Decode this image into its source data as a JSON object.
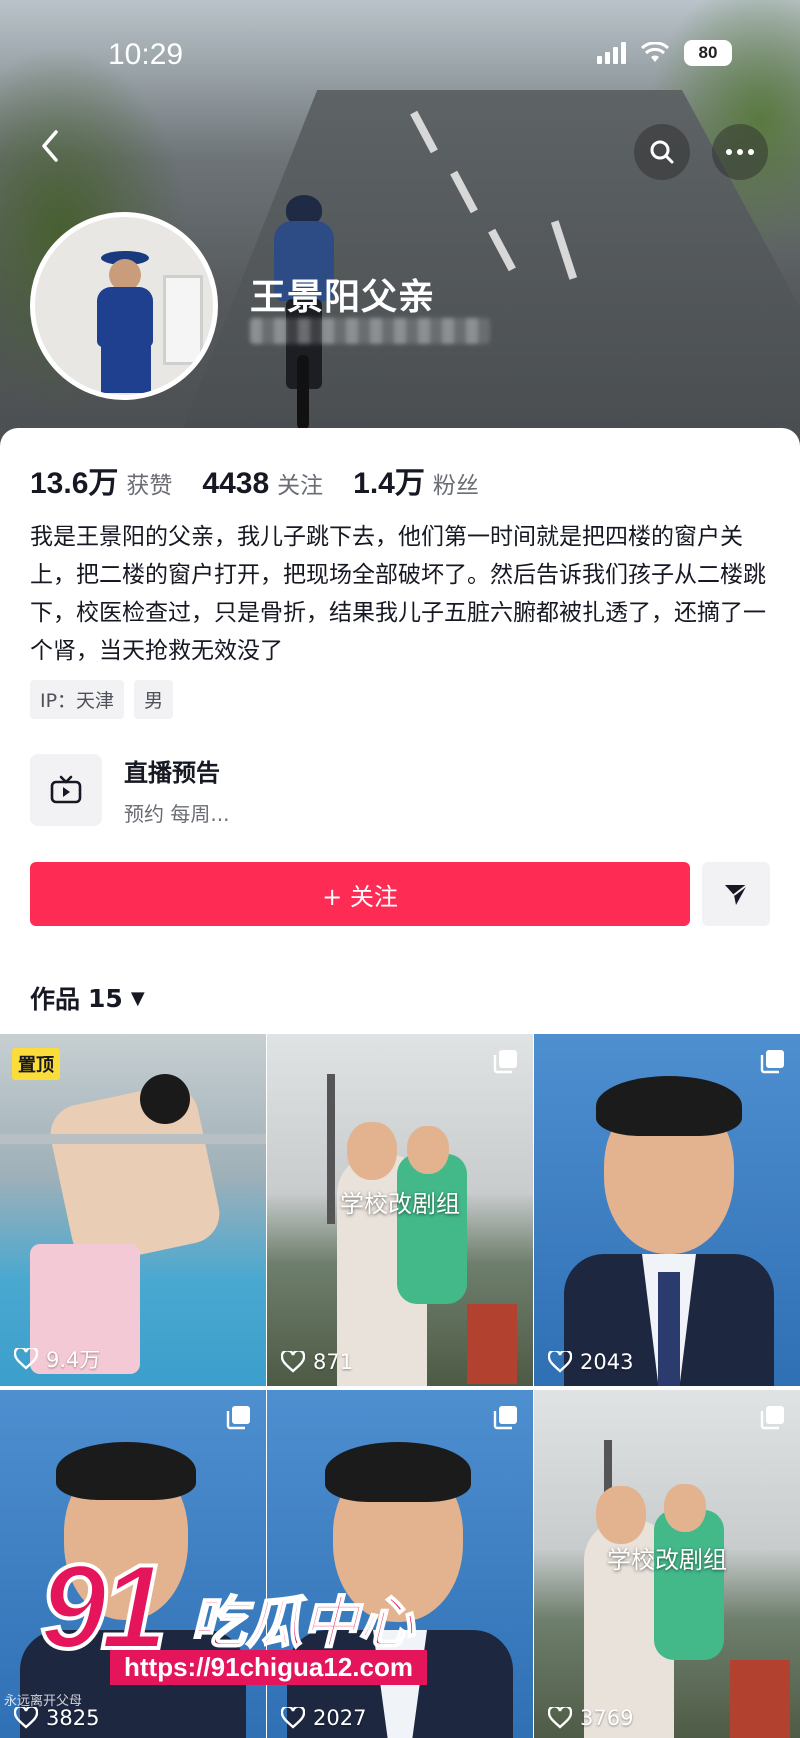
{
  "status_bar": {
    "time": "10:29",
    "battery": "80"
  },
  "profile": {
    "name": "王景阳父亲",
    "stats": [
      {
        "value": "13.6万",
        "label": "获赞"
      },
      {
        "value": "4438",
        "label": "关注"
      },
      {
        "value": "1.4万",
        "label": "粉丝"
      }
    ],
    "bio": "我是王景阳的父亲，我儿子跳下去，他们第一时间就是把四楼的窗户关上，把二楼的窗户打开，把现场全部破坏了。然后告诉我们孩子从二楼跳下，校医检查过，只是骨折，结果我儿子五脏六腑都被扎透了，还摘了一个肾，当天抢救无效没了",
    "tags": [
      "IP：天津",
      "男"
    ]
  },
  "live_preview": {
    "title": "直播预告",
    "subtitle": "预约 每周..."
  },
  "follow_button": {
    "label": "+ 关注"
  },
  "works": {
    "label": "作品",
    "count": "15"
  },
  "videos": [
    {
      "likes": "9.4万",
      "pinned_label": "置顶",
      "overlay": ""
    },
    {
      "likes": "871",
      "overlay": "学校改剧组"
    },
    {
      "likes": "2043",
      "overlay": ""
    },
    {
      "likes": "3825",
      "overlay": ""
    },
    {
      "likes": "2027",
      "overlay": ""
    },
    {
      "likes": "3769",
      "overlay": "学校改剧组"
    }
  ],
  "watermark": {
    "number": "91",
    "brand": "吃瓜中心",
    "url": "https://91chigua12.com",
    "small": "永远离开父母"
  }
}
